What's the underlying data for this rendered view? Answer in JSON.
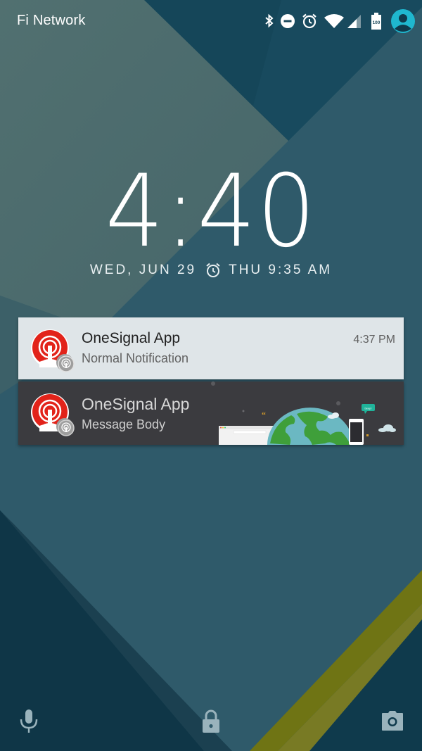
{
  "status_bar": {
    "carrier": "Fi Network",
    "icons": [
      "bluetooth-icon",
      "do-not-disturb-icon",
      "alarm-icon",
      "wifi-icon",
      "cell-signal-icon",
      "battery-icon",
      "user-avatar"
    ],
    "battery_level": "100",
    "avatar_color": "#1fb7cf"
  },
  "lockscreen": {
    "time": "4:40",
    "date": "WED, JUN 29",
    "next_alarm": "THU 9:35 AM"
  },
  "notifications": [
    {
      "app_name": "OneSignal App",
      "body": "Normal Notification",
      "time": "4:37 PM",
      "style": "light",
      "icon": "onesignal-logo-icon",
      "badge_icon": "onesignal-small-icon"
    },
    {
      "app_name": "OneSignal App",
      "body": "Message Body",
      "style": "dark-big-picture",
      "icon": "onesignal-logo-icon",
      "badge_icon": "onesignal-small-icon",
      "big_picture": {
        "description": "globe with browser window and phone",
        "bubble_text": "beep!"
      }
    }
  ],
  "bottom_bar": {
    "left": "microphone-icon",
    "center": "lock-icon",
    "right": "camera-icon"
  },
  "colors": {
    "brand_red": "#e2231a",
    "wallpaper_teal": "#2f5a6a",
    "wallpaper_dark": "#10394b",
    "wallpaper_gray": "#4a6767",
    "wallpaper_olive": "#6c7014"
  }
}
